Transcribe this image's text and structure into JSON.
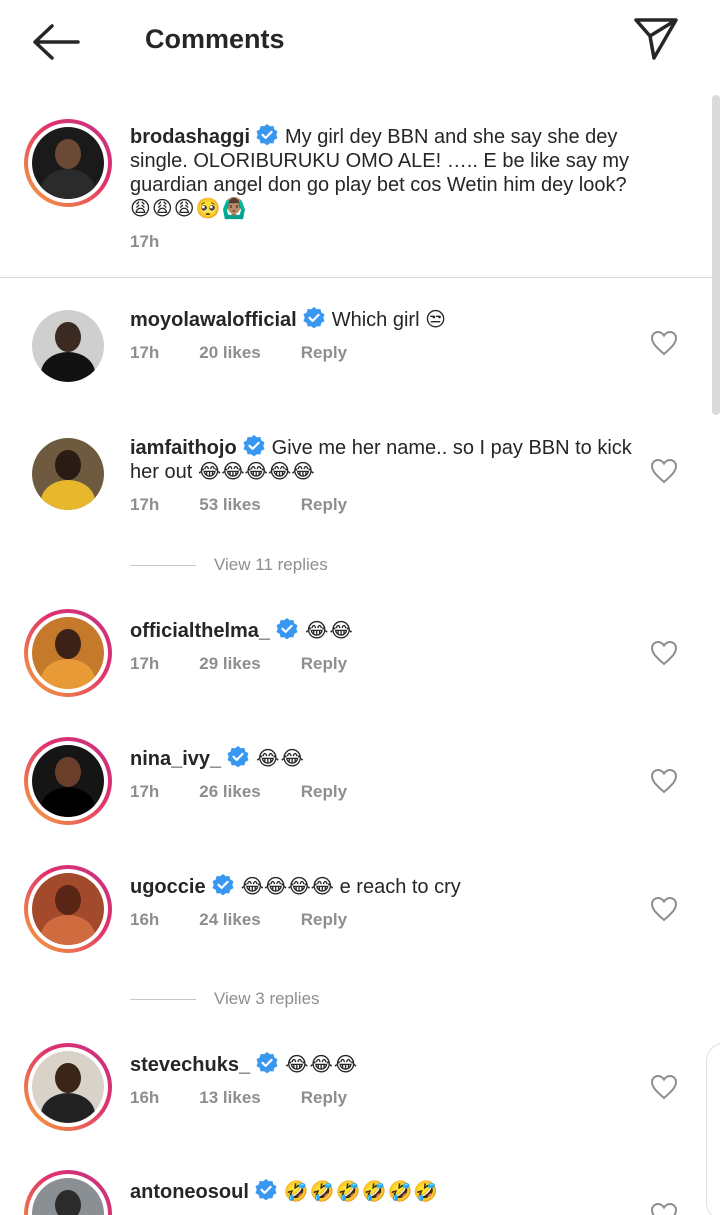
{
  "header": {
    "title": "Comments"
  },
  "caption": {
    "username": "brodashaggi",
    "text": "My girl dey BBN and she say she dey single. OLORIBURUKU OMO ALE! ….. E be like say my guardian angel don go play bet cos Wetin him dey look?",
    "emojis": "😩😩😩🥺🙆🏽‍♂️",
    "time": "17h"
  },
  "comments": [
    {
      "username": "moyolawalofficial",
      "text": "Which girl 😒",
      "time": "17h",
      "likes": "20 likes",
      "reply": "Reply"
    },
    {
      "username": "iamfaithojo",
      "text": "Give me her name.. so I pay BBN to kick her out 😂😂😂😂😂",
      "time": "17h",
      "likes": "53 likes",
      "reply": "Reply",
      "view_replies": "View 11 replies"
    },
    {
      "username": "officialthelma_",
      "text": "😂😂",
      "time": "17h",
      "likes": "29 likes",
      "reply": "Reply"
    },
    {
      "username": "nina_ivy_",
      "text": "😂😂",
      "time": "17h",
      "likes": "26 likes",
      "reply": "Reply"
    },
    {
      "username": "ugoccie",
      "text": "😂😂😂😂 e reach to cry",
      "time": "16h",
      "likes": "24 likes",
      "reply": "Reply",
      "view_replies": "View 3 replies"
    },
    {
      "username": "stevechuks_",
      "text": "😂😂😂",
      "time": "16h",
      "likes": "13 likes",
      "reply": "Reply"
    },
    {
      "username": "antoneosoul",
      "text": "🤣🤣🤣🤣🤣🤣"
    }
  ],
  "colors": {
    "verified": "#3897f0",
    "meta_text": "#8e8e8e",
    "ring_start": "#f5a83b",
    "ring_end": "#c13584"
  }
}
